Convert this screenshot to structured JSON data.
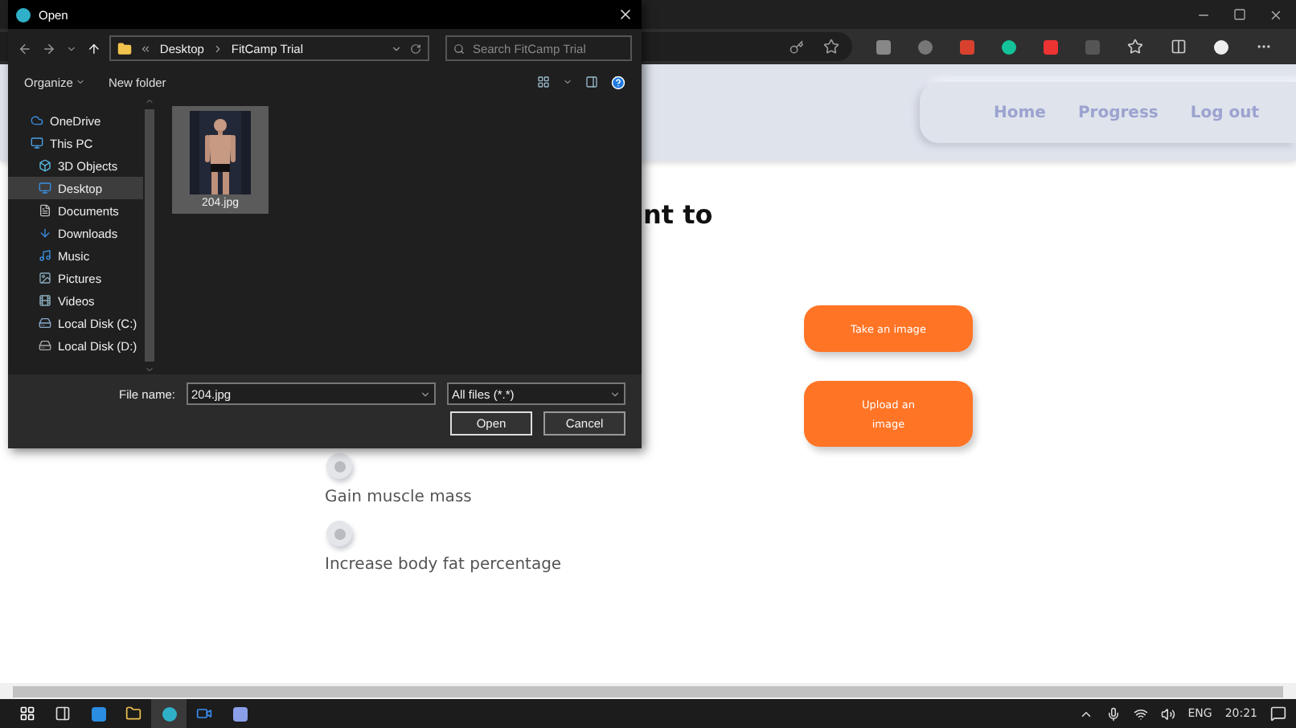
{
  "dialog": {
    "title": "Open",
    "address": [
      "Desktop",
      "FitCamp Trial"
    ],
    "search": {
      "placeholder": "Search FitCamp Trial"
    },
    "toolbar": [
      "Organize",
      "New folder"
    ],
    "sidebar": {
      "items": [
        {
          "label": "OneDrive",
          "kind": "cloud",
          "selected": false
        },
        {
          "label": "This PC",
          "kind": "computer",
          "selected": false,
          "children": [
            {
              "label": "3D Objects",
              "kind": "objects",
              "selected": false
            },
            {
              "label": "Desktop",
              "kind": "desktop",
              "selected": true
            },
            {
              "label": "Documents",
              "kind": "documents",
              "selected": false
            },
            {
              "label": "Downloads",
              "kind": "downloads",
              "selected": false
            },
            {
              "label": "Music",
              "kind": "music",
              "selected": false
            },
            {
              "label": "Pictures",
              "kind": "pictures",
              "selected": false
            },
            {
              "label": "Videos",
              "kind": "videos",
              "selected": false
            },
            {
              "label": "Local Disk (C:)",
              "kind": "system-disk",
              "selected": false
            },
            {
              "label": "Local Disk (D:)",
              "kind": "disk",
              "selected": false
            }
          ]
        }
      ]
    },
    "files": [
      {
        "name": "204.jpg",
        "kind": "picture",
        "selected": true
      }
    ],
    "file_name": {
      "label": "File name:",
      "value": "204.jpg"
    },
    "file_type": "All files (*.*)",
    "buttons": [
      {
        "label": "Open",
        "default": true
      },
      {
        "label": "Cancel",
        "default": false
      }
    ]
  },
  "page": {
    "nav": [
      "Home",
      "Progress",
      "Log out"
    ],
    "heading": "nt to",
    "options": [
      {
        "label": "Gain muscle mass",
        "selected": false
      },
      {
        "label": "Increase body fat percentage",
        "selected": false
      }
    ],
    "actions": [
      "Take an image",
      "Upload an image"
    ]
  },
  "taskbar": {
    "language": "ENG",
    "time": "20:21"
  }
}
